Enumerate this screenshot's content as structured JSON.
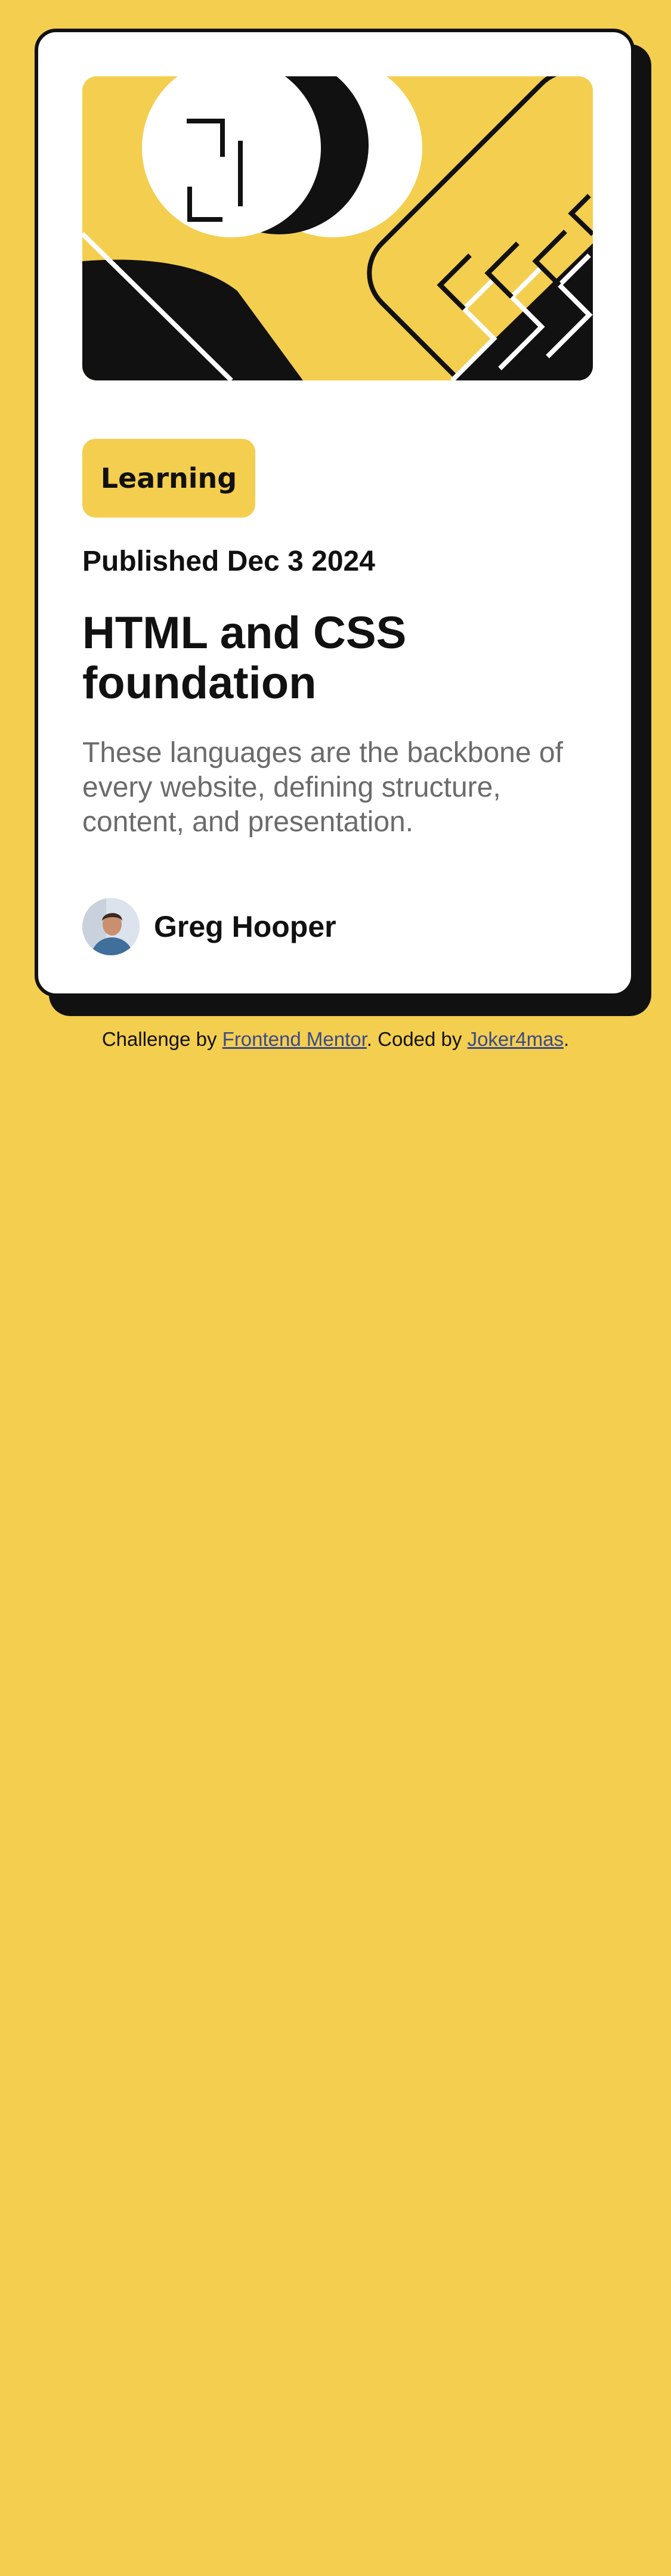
{
  "card": {
    "tag_label": "Learning",
    "published": "Published Dec 3 2024",
    "title": "HTML and CSS foundation",
    "description": "These languages are the backbone of every website, defining structure, content, and presentation.",
    "author_name": "Greg Hooper",
    "illustration_icon": "abstract-illustration",
    "avatar_icon": "author-avatar"
  },
  "footer": {
    "prefix": "Challenge by",
    "link1": "Frontend Mentor",
    "middle": ". Coded by",
    "link2": "Joker4mas",
    "suffix": "."
  },
  "colors": {
    "background": "#F4CE4E",
    "card": "#FFFFFF",
    "ink": "#111111",
    "muted_text": "#6B6B6B",
    "link": "#3A4A8C"
  }
}
